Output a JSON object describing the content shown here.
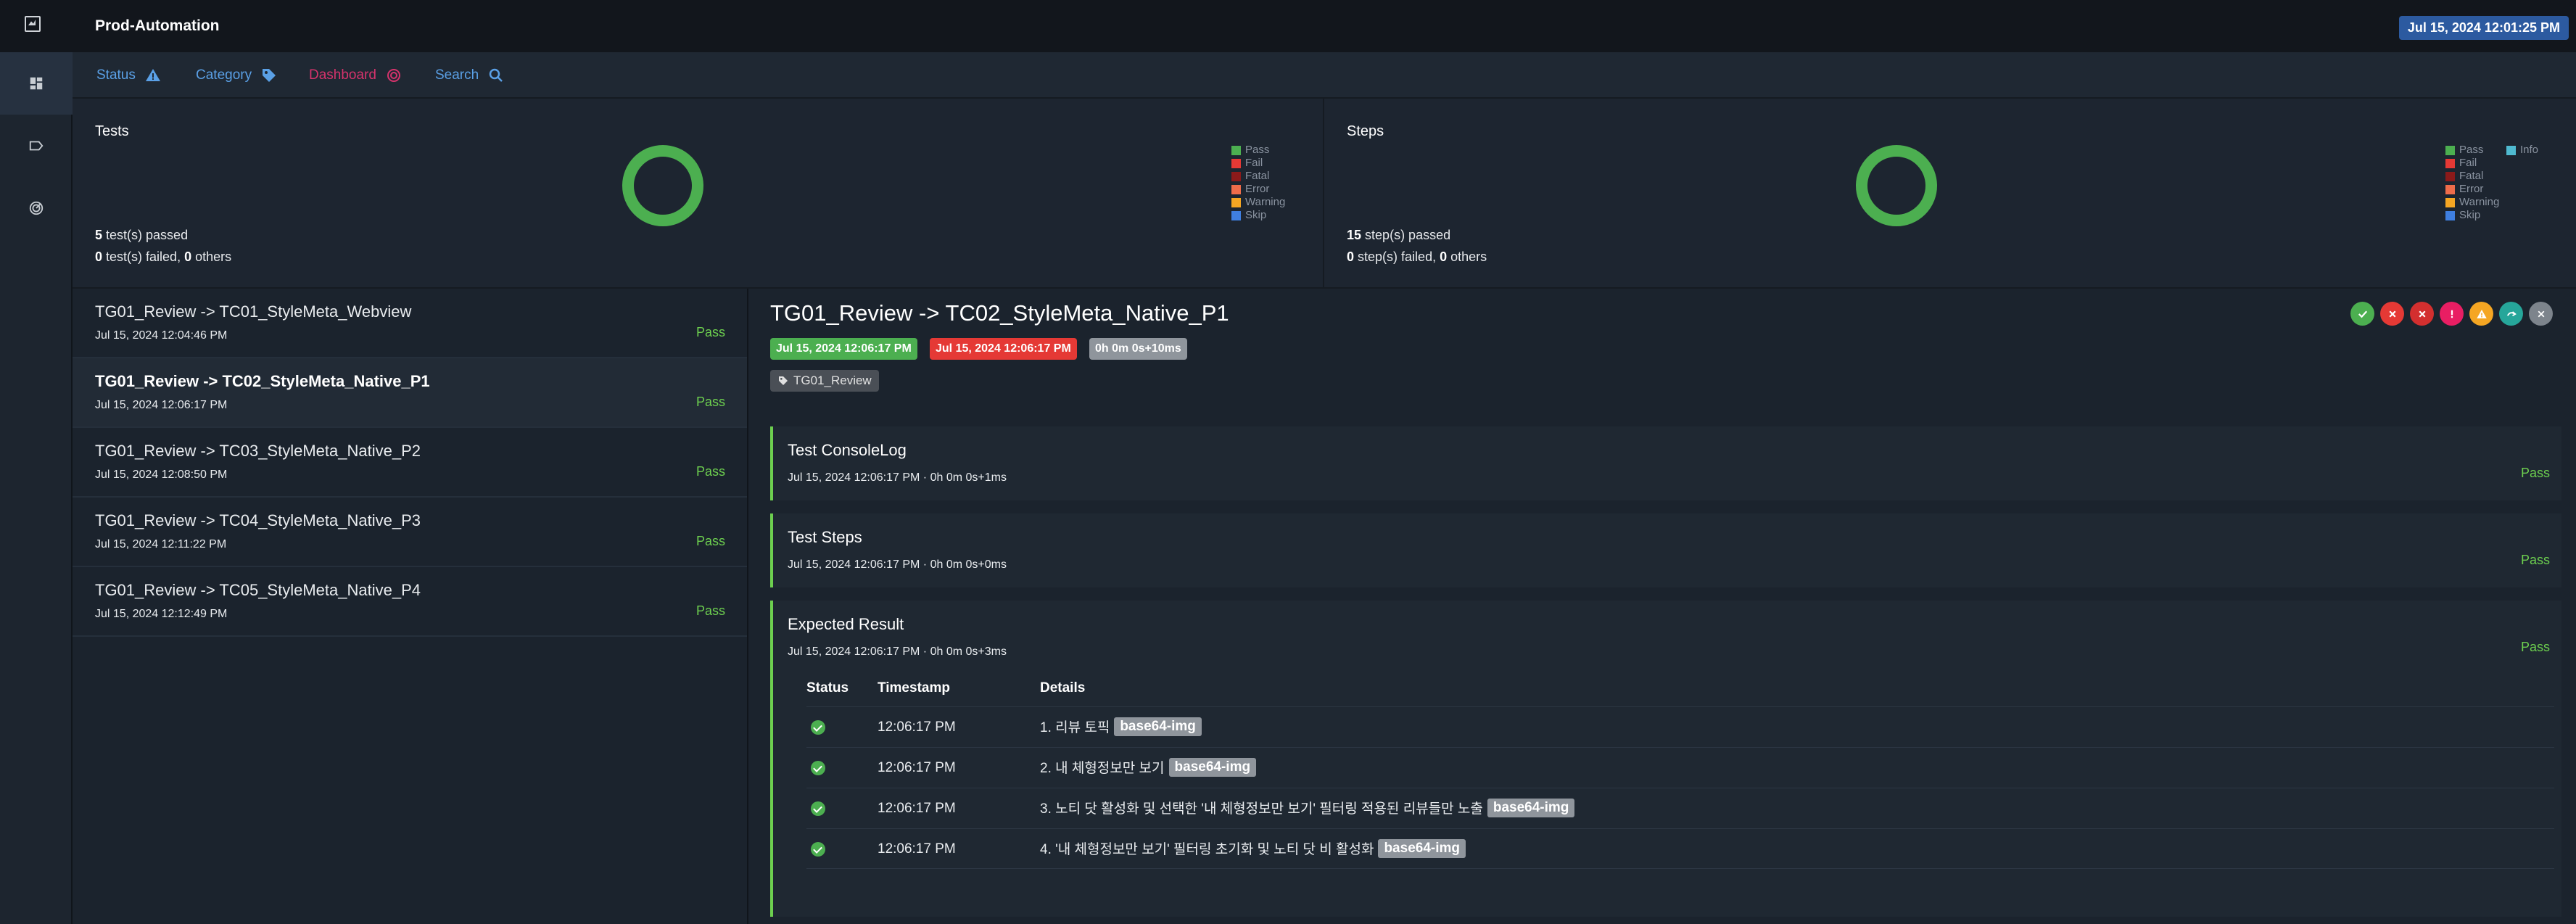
{
  "app": {
    "title": "Prod-Automation",
    "date": "Jul 15, 2024 12:01:25 PM"
  },
  "nav": [
    {
      "label": "Status",
      "icon": "warning-icon",
      "color": "#5aa0e6"
    },
    {
      "label": "Category",
      "icon": "tag-icon",
      "color": "#5aa0e6"
    },
    {
      "label": "Dashboard",
      "icon": "dashboard-icon",
      "color": "#d6336c"
    },
    {
      "label": "Search",
      "icon": "search-icon",
      "color": "#5aa0e6"
    }
  ],
  "tests_panel": {
    "title": "Tests",
    "legend": [
      "Pass",
      "Fail",
      "Fatal",
      "Error",
      "Warning",
      "Skip"
    ],
    "passed_count": "5",
    "passed_label": "test(s) passed",
    "failed_count": "0",
    "failed_label": "test(s) failed,",
    "others_count": "0",
    "others_label": "others"
  },
  "steps_panel": {
    "title": "Steps",
    "legend": [
      "Pass",
      "Fail",
      "Fatal",
      "Error",
      "Warning",
      "Skip"
    ],
    "legend_extra": "Info",
    "passed_count": "15",
    "passed_label": "step(s) passed",
    "failed_count": "0",
    "failed_label": "step(s) failed,",
    "others_count": "0",
    "others_label": "others"
  },
  "legend_colors": {
    "Pass": "#4caf50",
    "Fail": "#e53935",
    "Fatal": "#8b1a1a",
    "Error": "#ef6c4a",
    "Warning": "#f5a623",
    "Skip": "#3f7fe0",
    "Info": "#4fb9cf"
  },
  "tests": [
    {
      "name": "TG01_Review -> TC01_StyleMeta_Webview",
      "time": "Jul 15, 2024 12:04:46 PM",
      "status": "Pass"
    },
    {
      "name": "TG01_Review -> TC02_StyleMeta_Native_P1",
      "time": "Jul 15, 2024 12:06:17 PM",
      "status": "Pass"
    },
    {
      "name": "TG01_Review -> TC03_StyleMeta_Native_P2",
      "time": "Jul 15, 2024 12:08:50 PM",
      "status": "Pass"
    },
    {
      "name": "TG01_Review -> TC04_StyleMeta_Native_P3",
      "time": "Jul 15, 2024 12:11:22 PM",
      "status": "Pass"
    },
    {
      "name": "TG01_Review -> TC05_StyleMeta_Native_P4",
      "time": "Jul 15, 2024 12:12:49 PM",
      "status": "Pass"
    }
  ],
  "detail": {
    "title": "TG01_Review -> TC02_StyleMeta_Native_P1",
    "start": "Jul 15, 2024 12:06:17 PM",
    "end": "Jul 15, 2024 12:06:17 PM",
    "duration": "0h 0m 0s+10ms",
    "tag": "TG01_Review",
    "filters": [
      "pass-filter",
      "fail-filter",
      "fatal-filter",
      "error-filter",
      "warning-filter",
      "skip-filter",
      "clear-filter"
    ],
    "blocks": [
      {
        "title": "Test ConsoleLog",
        "meta": "Jul 15, 2024 12:06:17 PM · 0h 0m 0s+1ms",
        "status": "Pass"
      },
      {
        "title": "Test Steps",
        "meta": "Jul 15, 2024 12:06:17 PM · 0h 0m 0s+0ms",
        "status": "Pass"
      },
      {
        "title": "Expected Result",
        "meta": "Jul 15, 2024 12:06:17 PM · 0h 0m 0s+3ms",
        "status": "Pass"
      }
    ],
    "steps_headers": {
      "status": "Status",
      "timestamp": "Timestamp",
      "details": "Details"
    },
    "steps": [
      {
        "time": "12:06:17 PM",
        "text": "1. 리뷰 토픽",
        "tag": "base64-img"
      },
      {
        "time": "12:06:17 PM",
        "text": "2. 내 체형정보만 보기",
        "tag": "base64-img"
      },
      {
        "time": "12:06:17 PM",
        "text": "3. 노티 닷 활성화 및 선택한 '내 체형정보만 보기' 필터링 적용된 리뷰들만 노출",
        "tag": "base64-img"
      },
      {
        "time": "12:06:17 PM",
        "text": "4. '내 체형정보만 보기' 필터링 초기화 및 노티 닷 비 활성화",
        "tag": "base64-img"
      }
    ]
  }
}
